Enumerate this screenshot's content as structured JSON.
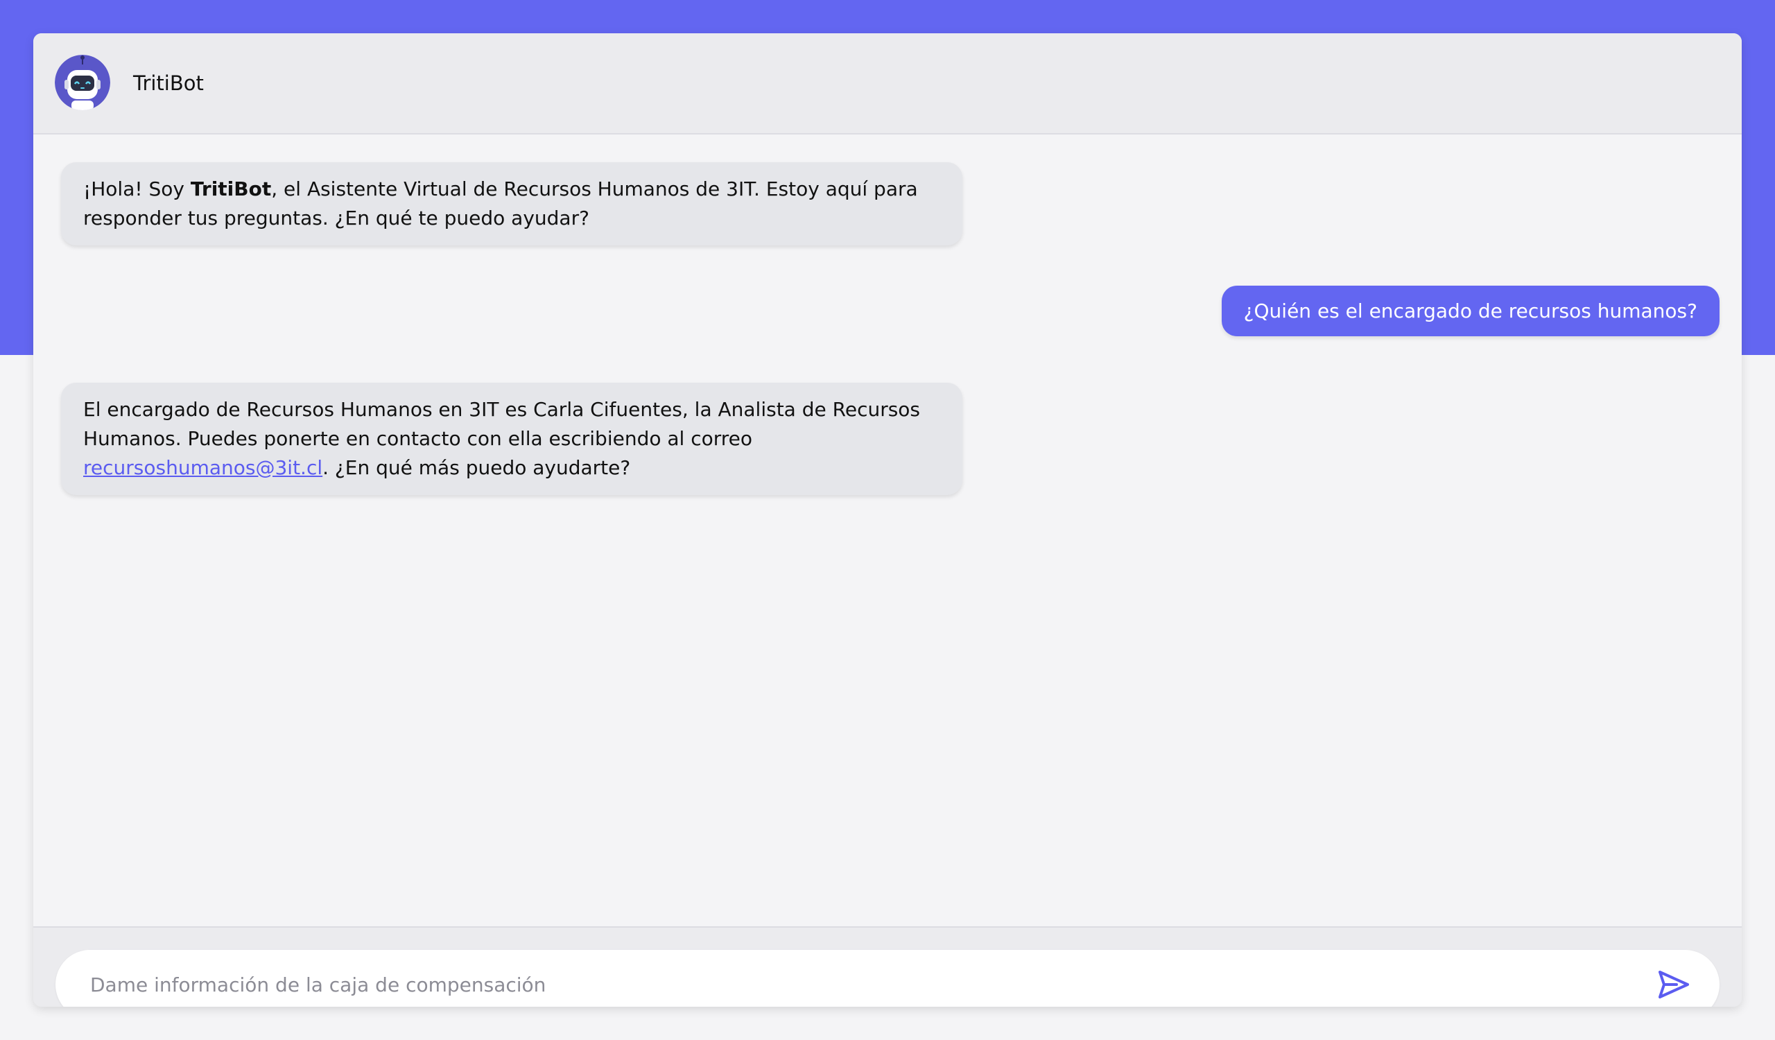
{
  "header": {
    "title": "TritiBot",
    "avatar_icon": "robot-icon"
  },
  "messages": [
    {
      "role": "bot",
      "parts": [
        {
          "text": "¡Hola! Soy "
        },
        {
          "text": "TritiBot",
          "bold": true
        },
        {
          "text": ", el Asistente Virtual de Recursos Humanos de 3IT. Estoy aquí para responder tus preguntas. ¿En qué te puedo ayudar?"
        }
      ]
    },
    {
      "role": "user",
      "text": "¿Quién es el encargado de recursos humanos?"
    },
    {
      "role": "bot",
      "parts": [
        {
          "text": "El encargado de Recursos Humanos en 3IT es Carla Cifuentes, la Analista de Recursos Humanos. Puedes ponerte en contacto con ella escribiendo al correo "
        },
        {
          "text": "recursoshumanos@3it.cl",
          "link": true
        },
        {
          "text": ". ¿En qué más puedo ayudarte?"
        }
      ]
    }
  ],
  "composer": {
    "placeholder": "Dame información de la caja de compensación",
    "value": "",
    "send_icon": "send-icon"
  },
  "colors": {
    "accent": "#6366f1",
    "bot_bubble": "#e5e6ea",
    "header_bg": "#ebebee",
    "link": "#5b5cf0"
  }
}
